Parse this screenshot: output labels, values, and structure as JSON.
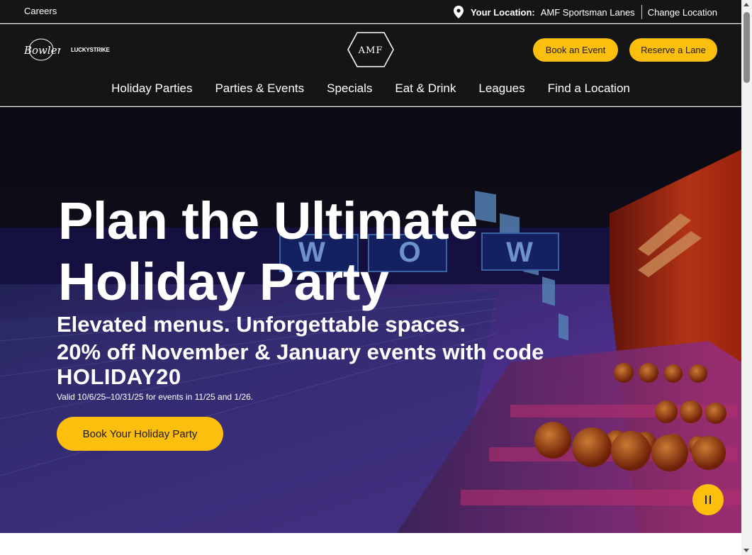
{
  "utility": {
    "careers": "Careers",
    "location_label": "Your Location:",
    "location_name": "AMF Sportsman Lanes",
    "change_location": "Change Location"
  },
  "brands": {
    "bowlero": "Bowlero",
    "lucky_strike": "LUCKYSTRIKE",
    "amf": "AMF"
  },
  "header": {
    "book_event": "Book an Event",
    "reserve_lane": "Reserve a Lane"
  },
  "nav": {
    "items": [
      {
        "label": "Holiday Parties"
      },
      {
        "label": "Parties & Events"
      },
      {
        "label": "Specials"
      },
      {
        "label": "Eat & Drink"
      },
      {
        "label": "Leagues"
      },
      {
        "label": "Find a Location"
      }
    ]
  },
  "hero": {
    "title": "Plan the Ultimate Holiday Party",
    "subtitle_line1": "Elevated menus. Unforgettable spaces.",
    "subtitle_line2": "20% off November & January events with code",
    "code": "HOLIDAY20",
    "valid": "Valid 10/6/25–10/31/25 for events in 11/25 and 1/26.",
    "cta": "Book Your Holiday Party",
    "wall_letters": [
      "W",
      "O",
      "W"
    ]
  },
  "colors": {
    "accent": "#fdbf0e",
    "header_bg": "#151515"
  },
  "icons": {
    "location": "location-pin-icon",
    "pause": "pause-icon"
  }
}
